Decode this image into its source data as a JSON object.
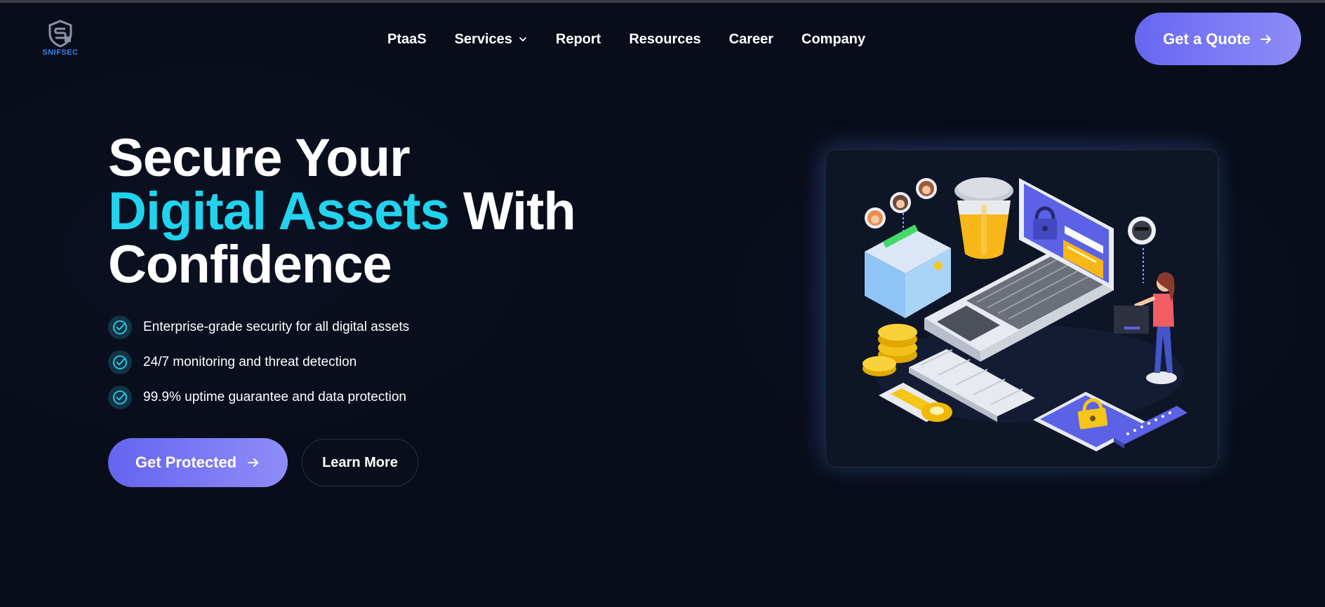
{
  "brand": {
    "name": "SNIFSEC",
    "color": "#3b82f6"
  },
  "nav": {
    "items": [
      {
        "label": "PtaaS",
        "has_dropdown": false
      },
      {
        "label": "Services",
        "has_dropdown": true
      },
      {
        "label": "Report",
        "has_dropdown": false
      },
      {
        "label": "Resources",
        "has_dropdown": false
      },
      {
        "label": "Career",
        "has_dropdown": false
      },
      {
        "label": "Company",
        "has_dropdown": false
      }
    ],
    "cta_label": "Get a Quote"
  },
  "hero": {
    "title_line1": "Secure Your",
    "title_accent": "Digital Assets",
    "title_line2_rest": " With",
    "title_line3": "Confidence",
    "features": [
      "Enterprise-grade security for all digital assets",
      "24/7 monitoring and threat detection",
      "99.9% uptime guarantee and data protection"
    ],
    "primary_button": "Get Protected",
    "secondary_button": "Learn More"
  },
  "colors": {
    "background": "#090d1a",
    "accent": "#22d3ee",
    "button_gradient_start": "#6464f0",
    "button_gradient_end": "#8f8df8"
  },
  "icons": [
    "shield-logo-icon",
    "chevron-down-icon",
    "arrow-right-icon",
    "check-circle-icon",
    "security-illustration"
  ]
}
